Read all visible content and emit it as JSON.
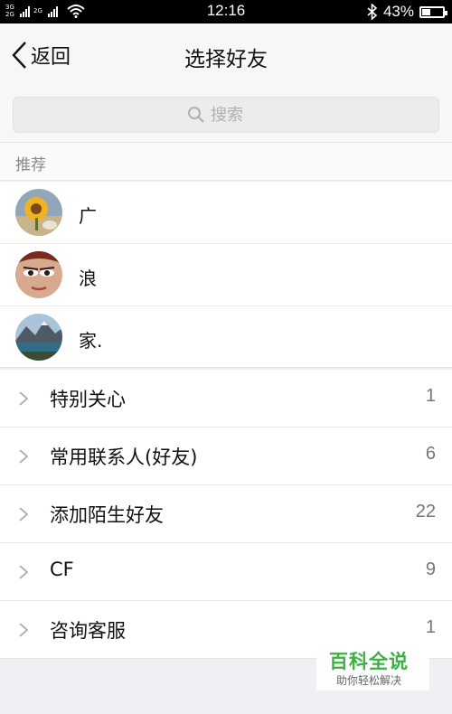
{
  "status_bar": {
    "network1": "3G",
    "network2": "2G",
    "network3": "2G",
    "time": "12:16",
    "battery_level": 0.43,
    "battery_text": "43%",
    "bluetooth_icon": "bluetooth-icon",
    "wifi_icon": "wifi-icon"
  },
  "nav": {
    "back_label": "返回",
    "title": "选择好友"
  },
  "search": {
    "placeholder": "搜索"
  },
  "recommended": {
    "header": "推荐",
    "friends": [
      {
        "name": "广",
        "avatar": "sunflower-avatar"
      },
      {
        "name": "浪",
        "avatar": "face-avatar"
      },
      {
        "name": "家.",
        "avatar": "mountain-lake-avatar"
      }
    ]
  },
  "groups": [
    {
      "name": "特别关心",
      "count": "1"
    },
    {
      "name": "常用联系人(好友)",
      "count": "6"
    },
    {
      "name": "添加陌生好友",
      "count": "22"
    },
    {
      "name": "CF",
      "count": "9"
    },
    {
      "name": "咨询客服",
      "count": "1"
    }
  ],
  "watermark": {
    "title": "百科全说",
    "subtitle": "助你轻松解决"
  },
  "colors": {
    "watermark_green": "#3cb043",
    "status_bar_bg": "#000000",
    "nav_bg": "#f7f7f7",
    "page_bg": "#efeff4"
  }
}
